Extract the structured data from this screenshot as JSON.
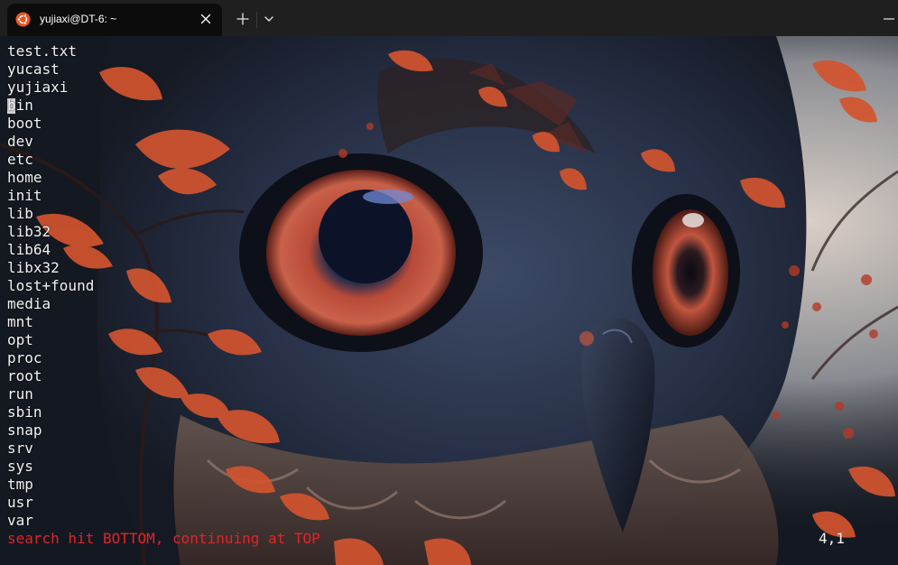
{
  "window": {
    "tab_title": "yujiaxi@DT-6: ~",
    "tab_icon": "ubuntu-logo-icon",
    "accent_color": "#e95420"
  },
  "terminal": {
    "lines": [
      "test.txt",
      "yucast",
      "yujiaxi",
      "bin",
      "boot",
      "dev",
      "etc",
      "home",
      "init",
      "lib",
      "lib32",
      "lib64",
      "libx32",
      "lost+found",
      "media",
      "mnt",
      "opt",
      "proc",
      "root",
      "run",
      "sbin",
      "snap",
      "srv",
      "sys",
      "tmp",
      "usr",
      "var"
    ],
    "status_message": "search hit BOTTOM, continuing at TOP",
    "status_message_color": "#e0242a",
    "cursor_position": "4,1"
  }
}
